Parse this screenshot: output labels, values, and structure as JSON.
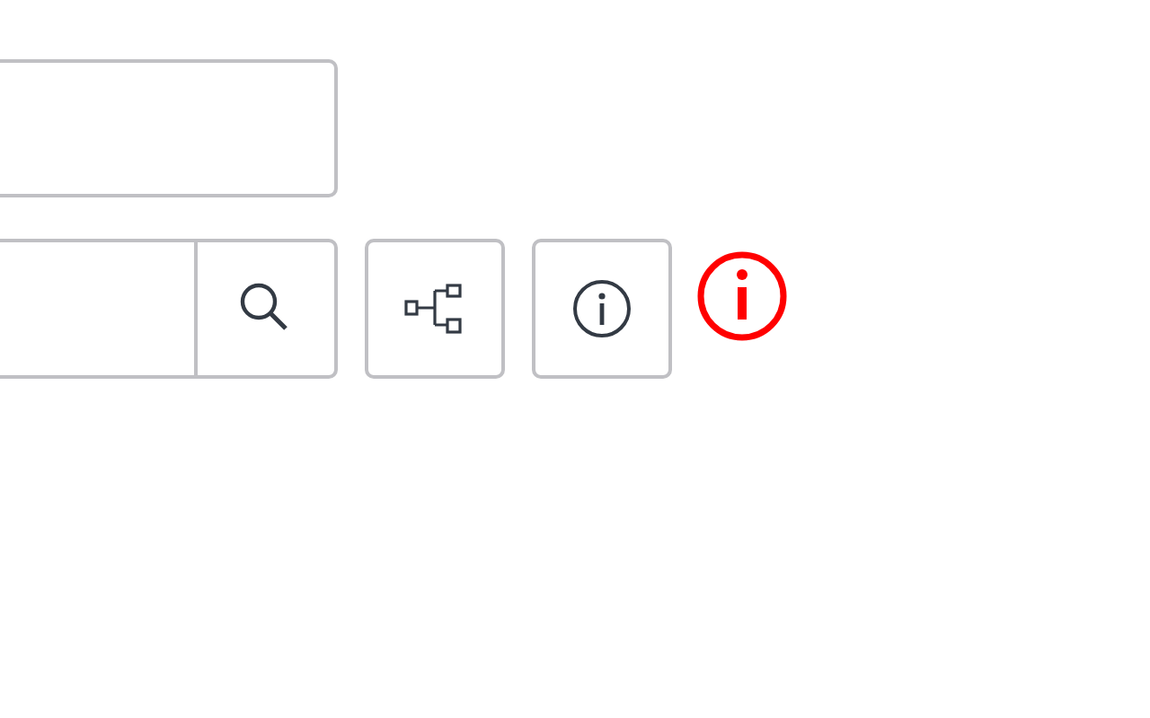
{
  "validation": {
    "error": true
  }
}
